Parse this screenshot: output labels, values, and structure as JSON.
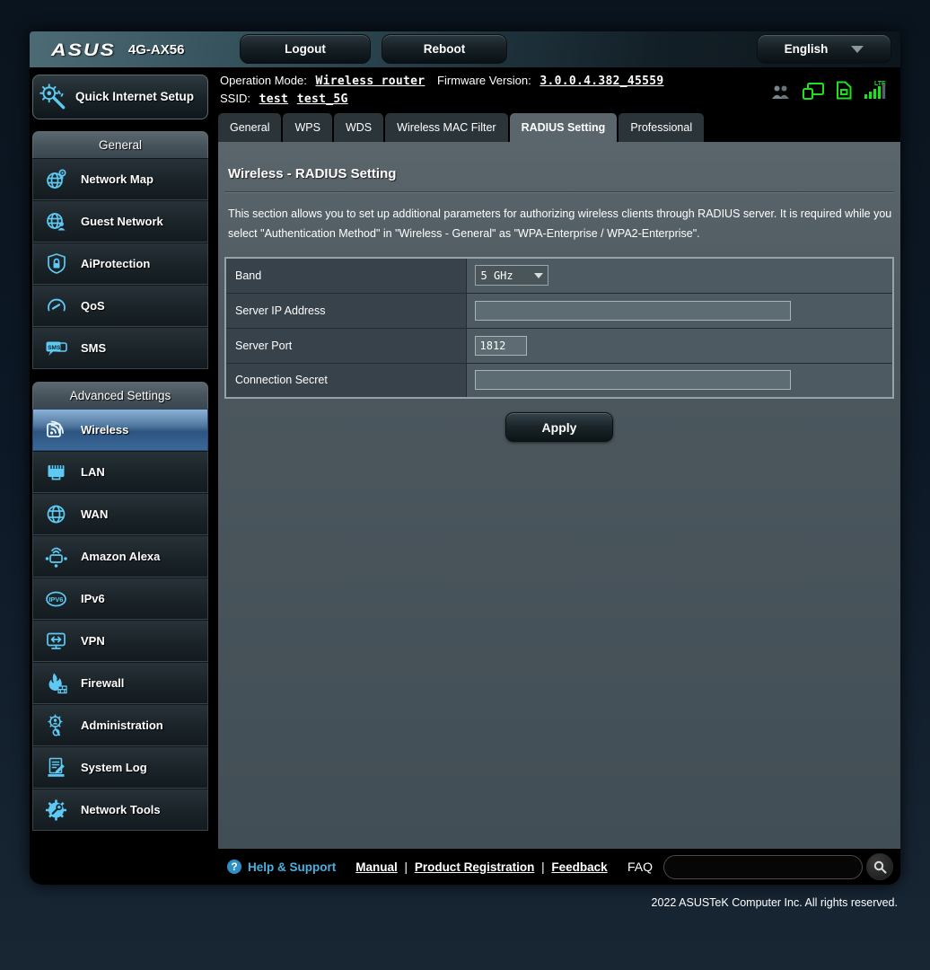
{
  "header": {
    "brand": "ASUS",
    "model": "4G-AX56",
    "logout_label": "Logout",
    "reboot_label": "Reboot",
    "language": "English"
  },
  "status_bar": {
    "operation_mode_label": "Operation Mode:",
    "operation_mode_value": "Wireless router",
    "firmware_label": "Firmware Version:",
    "firmware_value": "3.0.0.4.382_45559",
    "ssid_label": "SSID:",
    "ssid_values": [
      "test",
      "test_5G"
    ]
  },
  "tabs": [
    {
      "label": "General",
      "active": false
    },
    {
      "label": "WPS",
      "active": false
    },
    {
      "label": "WDS",
      "active": false
    },
    {
      "label": "Wireless MAC Filter",
      "active": false
    },
    {
      "label": "RADIUS Setting",
      "active": true
    },
    {
      "label": "Professional",
      "active": false
    }
  ],
  "page": {
    "title": "Wireless - RADIUS Setting",
    "description": "This section allows you to set up additional parameters for authorizing wireless clients through RADIUS server. It is required while you select \"Authentication Method\" in \"Wireless - General\" as \"WPA-Enterprise / WPA2-Enterprise\".",
    "apply_label": "Apply"
  },
  "form": {
    "rows": [
      {
        "label": "Band",
        "type": "select",
        "value": "5 GHz"
      },
      {
        "label": "Server IP Address",
        "type": "text",
        "value": ""
      },
      {
        "label": "Server Port",
        "type": "text",
        "value": "1812"
      },
      {
        "label": "Connection Secret",
        "type": "text",
        "value": ""
      }
    ]
  },
  "sidebar": {
    "qis_label": "Quick Internet Setup",
    "sections": [
      {
        "title": "General",
        "items": [
          {
            "label": "Network Map"
          },
          {
            "label": "Guest Network"
          },
          {
            "label": "AiProtection"
          },
          {
            "label": "QoS"
          },
          {
            "label": "SMS"
          }
        ]
      },
      {
        "title": "Advanced Settings",
        "items": [
          {
            "label": "Wireless",
            "active": true
          },
          {
            "label": "LAN"
          },
          {
            "label": "WAN"
          },
          {
            "label": "Amazon Alexa"
          },
          {
            "label": "IPv6"
          },
          {
            "label": "VPN"
          },
          {
            "label": "Firewall"
          },
          {
            "label": "Administration"
          },
          {
            "label": "System Log"
          },
          {
            "label": "Network Tools"
          }
        ]
      }
    ]
  },
  "footer": {
    "help_icon_glyph": "?",
    "help_label": "Help & Support",
    "links": [
      "Manual",
      "Product Registration",
      "Feedback"
    ],
    "separator": "|",
    "faq_label": "FAQ",
    "copyright": "2022 ASUSTeK Computer Inc. All rights reserved."
  },
  "colors": {
    "accent_blue": "#5ec9f2",
    "status_green": "#1fe11f",
    "active_item_blue": "#2e5480",
    "panel_gray": "#4c585e"
  }
}
